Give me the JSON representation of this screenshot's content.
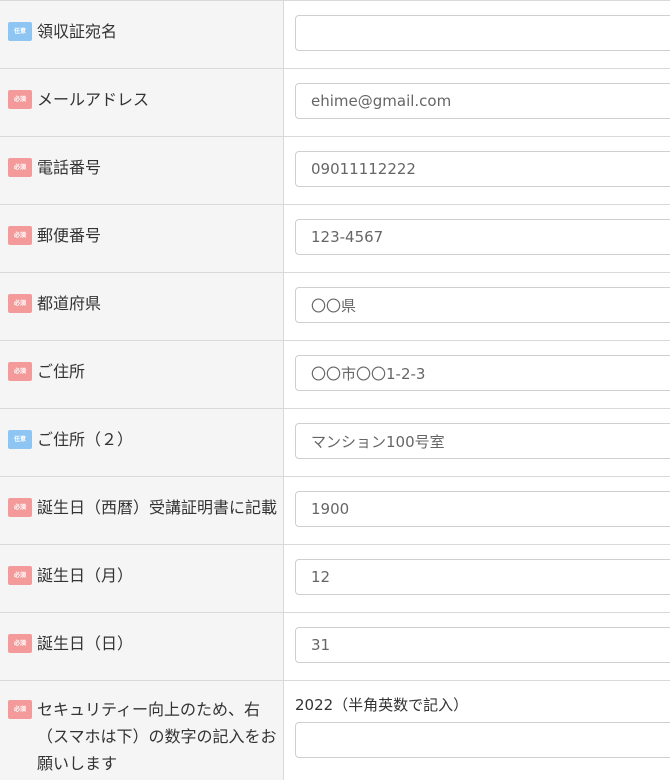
{
  "badges": {
    "required": "必須",
    "optional": "任意"
  },
  "fields": [
    {
      "label": "領収証宛名",
      "badge": "任意",
      "value": ""
    },
    {
      "label": "メールアドレス",
      "badge": "必須",
      "value": "ehime@gmail.com"
    },
    {
      "label": "電話番号",
      "badge": "必須",
      "value": "09011112222"
    },
    {
      "label": "郵便番号",
      "badge": "必須",
      "value": "123-4567"
    },
    {
      "label": "都道府県",
      "badge": "必須",
      "value": "〇〇県"
    },
    {
      "label": "ご住所",
      "badge": "必須",
      "value": "〇〇市〇〇1-2-3"
    },
    {
      "label": "ご住所（２）",
      "badge": "任意",
      "value": "マンション100号室"
    },
    {
      "label": "誕生日（西暦）受講証明書に記載",
      "badge": "必須",
      "value": "1900"
    },
    {
      "label": "誕生日（月）",
      "badge": "必須",
      "value": "12"
    },
    {
      "label": "誕生日（日）",
      "badge": "必須",
      "value": "31"
    },
    {
      "label": "セキュリティー向上のため、右（スマホは下）の数字の記入をお願いします",
      "badge": "必須",
      "value": "",
      "note": "2022（半角英数で記入）"
    }
  ],
  "colors": {
    "required_badge": "#f59a9a",
    "optional_badge": "#8ec5f2",
    "label_bg": "#f5f5f5",
    "border": "#d9d9d9"
  }
}
